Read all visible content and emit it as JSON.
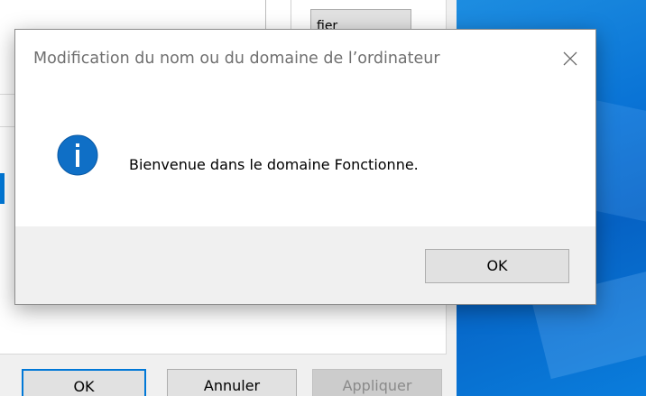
{
  "background_window": {
    "top_button_label": "fier",
    "buttons": {
      "ok": "OK",
      "cancel": "Annuler",
      "apply": "Appliquer"
    }
  },
  "dialog": {
    "title": "Modification du nom ou du domaine de l’ordinateur",
    "message": "Bienvenue dans le domaine Fonctionne.",
    "ok_label": "OK",
    "icon": "info-icon",
    "icon_color": "#0f6fc6"
  },
  "colors": {
    "desktop_blue": "#0a74d6",
    "focus_border": "#0078d7"
  }
}
